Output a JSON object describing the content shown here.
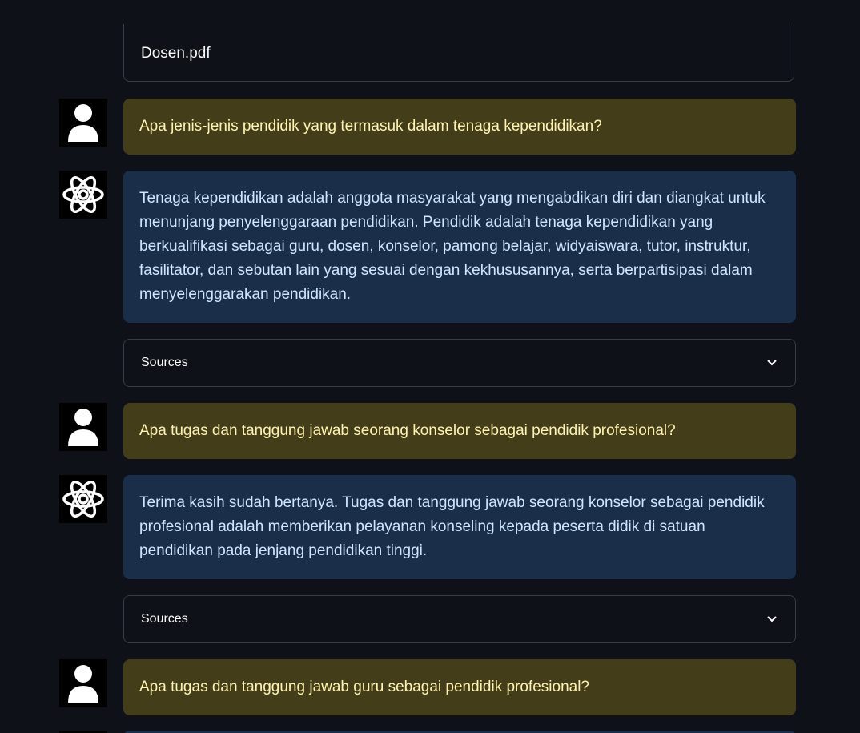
{
  "top_source": {
    "filename": "Dosen.pdf"
  },
  "messages": [
    {
      "role": "user",
      "avatar_icon": "user-icon",
      "text": "Apa jenis-jenis pendidik yang termasuk dalam tenaga kependidikan?"
    },
    {
      "role": "assistant",
      "avatar_icon": "atom-icon",
      "text": "Tenaga kependidikan adalah anggota masyarakat yang mengabdikan diri dan diangkat untuk menunjang penyelenggaraan pendidikan. Pendidik adalah tenaga kependidikan yang berkualifikasi sebagai guru, dosen, konselor, pamong belajar, widyaiswara, tutor, instruktur, fasilitator, dan sebutan lain yang sesuai dengan kekhususannya, serta berpartisipasi dalam menyelenggarakan pendidikan."
    },
    {
      "role": "expander",
      "label": "Sources",
      "icon": "chevron-down-icon"
    },
    {
      "role": "user",
      "avatar_icon": "user-icon",
      "text": "Apa tugas dan tanggung jawab seorang konselor sebagai pendidik profesional?"
    },
    {
      "role": "assistant",
      "avatar_icon": "atom-icon",
      "text": "Terima kasih sudah bertanya. Tugas dan tanggung jawab seorang konselor sebagai pendidik profesional adalah memberikan pelayanan konseling kepada peserta didik di satuan pendidikan pada jenjang pendidikan tinggi."
    },
    {
      "role": "expander",
      "label": "Sources",
      "icon": "chevron-down-icon"
    },
    {
      "role": "user",
      "avatar_icon": "user-icon",
      "text": "Apa tugas dan tanggung jawab guru sebagai pendidik profesional?"
    }
  ],
  "colors": {
    "background": "#0e1117",
    "user_bubble": "#433d1a",
    "user_text": "#fff3b0",
    "assistant_bubble": "#1a2e4a",
    "assistant_text": "#cfe6ff",
    "border": "#3a3d45"
  }
}
